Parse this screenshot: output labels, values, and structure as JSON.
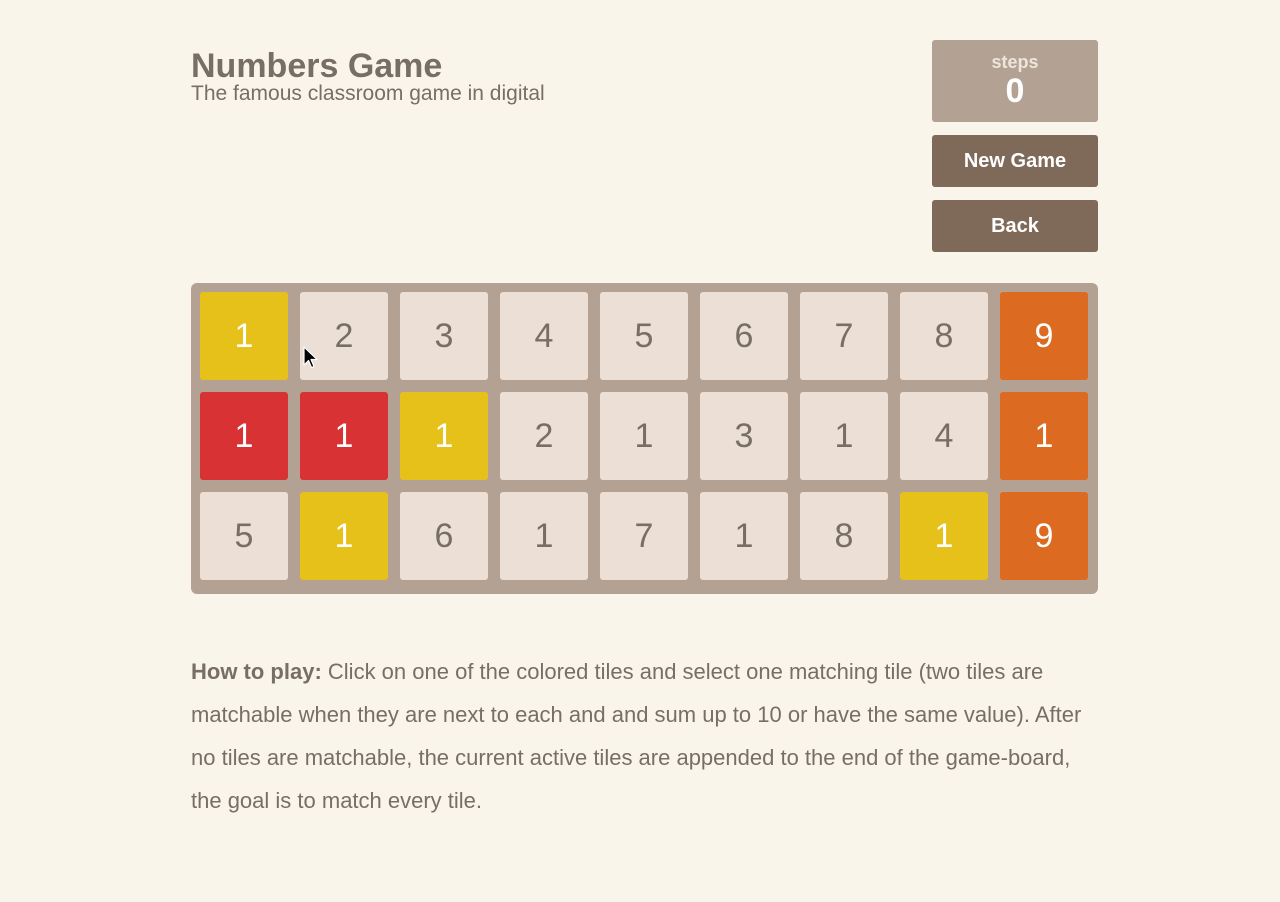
{
  "header": {
    "title": "Numbers Game",
    "subtitle": "The famous classroom game in digital"
  },
  "score": {
    "label": "steps",
    "value": "0"
  },
  "buttons": {
    "new_game": "New Game",
    "back": "Back"
  },
  "board": {
    "columns": 9,
    "rows": [
      [
        {
          "value": "1",
          "state": "yellow"
        },
        {
          "value": "2",
          "state": "plain"
        },
        {
          "value": "3",
          "state": "plain"
        },
        {
          "value": "4",
          "state": "plain"
        },
        {
          "value": "5",
          "state": "plain"
        },
        {
          "value": "6",
          "state": "plain"
        },
        {
          "value": "7",
          "state": "plain"
        },
        {
          "value": "8",
          "state": "plain"
        },
        {
          "value": "9",
          "state": "orange"
        }
      ],
      [
        {
          "value": "1",
          "state": "red"
        },
        {
          "value": "1",
          "state": "red"
        },
        {
          "value": "1",
          "state": "yellow"
        },
        {
          "value": "2",
          "state": "plain"
        },
        {
          "value": "1",
          "state": "plain"
        },
        {
          "value": "3",
          "state": "plain"
        },
        {
          "value": "1",
          "state": "plain"
        },
        {
          "value": "4",
          "state": "plain"
        },
        {
          "value": "1",
          "state": "orange"
        }
      ],
      [
        {
          "value": "5",
          "state": "plain"
        },
        {
          "value": "1",
          "state": "yellow"
        },
        {
          "value": "6",
          "state": "plain"
        },
        {
          "value": "1",
          "state": "plain"
        },
        {
          "value": "7",
          "state": "plain"
        },
        {
          "value": "1",
          "state": "plain"
        },
        {
          "value": "8",
          "state": "plain"
        },
        {
          "value": "1",
          "state": "yellow"
        },
        {
          "value": "9",
          "state": "orange"
        }
      ]
    ]
  },
  "instructions": {
    "heading": "How to play:",
    "text": "Click on one of the colored tiles and select one matching tile (two tiles are matchable when they are next to each and and sum up to 10 or have the same value). After no tiles are matchable, the current active tiles are appended to the end of the game-board, the goal is to match every tile."
  },
  "colors": {
    "background": "#faf5eb",
    "board": "#b3a294",
    "tile_plain": "#ece0d6",
    "tile_yellow": "#e6c119",
    "tile_red": "#d93235",
    "tile_orange": "#dc6a20",
    "button": "#7f6a5a",
    "text": "#776e65"
  }
}
